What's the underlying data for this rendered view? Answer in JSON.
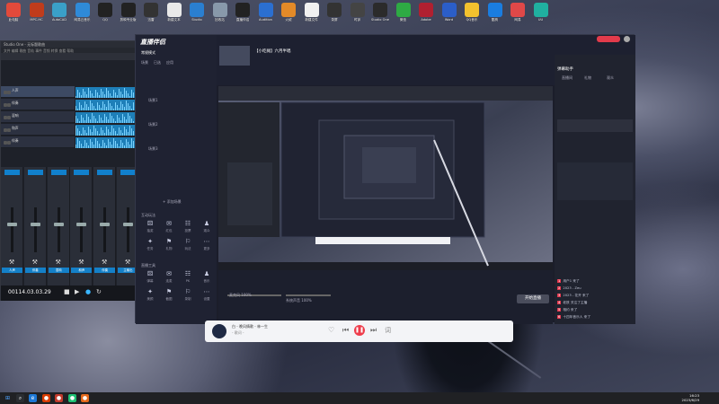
{
  "desktop_icons": [
    {
      "label": "此电脑",
      "color": "#e24a3b"
    },
    {
      "label": "MPC-HC",
      "color": "#c03c1c"
    },
    {
      "label": "AutoCAD",
      "color": "#3aa0c8"
    },
    {
      "label": "网易云音乐",
      "color": "#2f8ad8"
    },
    {
      "label": "QQ",
      "color": "#222"
    },
    {
      "label": "剪映专业版",
      "color": "#222"
    },
    {
      "label": "迅雷",
      "color": "#333"
    },
    {
      "label": "新建文本",
      "color": "#e9e9e9"
    },
    {
      "label": "Studio",
      "color": "#2a7fd0"
    },
    {
      "label": "回收站",
      "color": "#8899aa"
    },
    {
      "label": "直播伴侣",
      "color": "#222"
    },
    {
      "label": "Audition",
      "color": "#2b6fd0"
    },
    {
      "label": "火绒",
      "color": "#e38a28"
    },
    {
      "label": "新建文件",
      "color": "#f0f0f0"
    },
    {
      "label": "录屏",
      "color": "#333"
    },
    {
      "label": "时钟",
      "color": "#444"
    },
    {
      "label": "Studio One",
      "color": "#2b2b2b"
    },
    {
      "label": "微信",
      "color": "#2eaa44"
    },
    {
      "label": "Adobe",
      "color": "#b02030"
    },
    {
      "label": "Word",
      "color": "#2b5ec8"
    },
    {
      "label": "QQ音乐",
      "color": "#f2c12e"
    },
    {
      "label": "酷狗",
      "color": "#1a7de0"
    },
    {
      "label": "网易",
      "color": "#e04848"
    },
    {
      "label": "UU",
      "color": "#20b0a0"
    }
  ],
  "studio": {
    "title": "Studio One - 无标题歌曲",
    "menu": "文件  编辑  歌曲  音轨  事件  音频  转换  查看  帮助",
    "tracks": [
      "人声",
      "伴奏",
      "混响",
      "和声",
      "伴奏"
    ],
    "channels": [
      "人声",
      "伴奏",
      "混响",
      "和声",
      "伴奏",
      "主输出"
    ],
    "time": "00114.03.03.29"
  },
  "obs": {
    "title": "直播伴侣",
    "scene_label": "常规模式",
    "scene_tabs": [
      "场景",
      "已选",
      "应用"
    ],
    "scenes": [
      "场景1",
      "场景2",
      "场景3"
    ],
    "add_scene": "+ 添加场景",
    "sections": [
      {
        "title": "互动玩法",
        "items": [
          "抽奖",
          "红包",
          "投票",
          "观众",
          "任务",
          "礼物",
          "玩法",
          "更多"
        ]
      },
      {
        "title": "直播工具",
        "items": [
          "弹幕",
          "连麦",
          "PK",
          "音乐",
          "美颜",
          "截图",
          "录制",
          "设置"
        ]
      }
    ],
    "live_title": "【小吃摊】六月半唱",
    "preview_tabs": [
      "横屏",
      "竖屏"
    ],
    "volume": [
      "麦克风 100%",
      "系统声音 100%"
    ],
    "start_label": "开始直播",
    "right_title": "弹幕助手",
    "right_tabs": [
      "直播间",
      "礼物",
      "观众"
    ],
    "chat": [
      {
        "badge": "1",
        "text": "用户1  来了"
      },
      {
        "badge": "2",
        "text": "2023 - Zeu"
      },
      {
        "badge": "3",
        "text": "2023 - 花开 来了"
      },
      {
        "badge": "4",
        "text": "老铁  关注了主播"
      },
      {
        "badge": "5",
        "text": "相约  来了"
      },
      {
        "badge": "6",
        "text": "十四年音乐人  来了"
      }
    ]
  },
  "player": {
    "song": "白 - 晚风情歌 - 林一生",
    "lyric": "- 歌词 -"
  },
  "taskbar": {
    "time": "16:23",
    "date": "2023/6/29"
  }
}
